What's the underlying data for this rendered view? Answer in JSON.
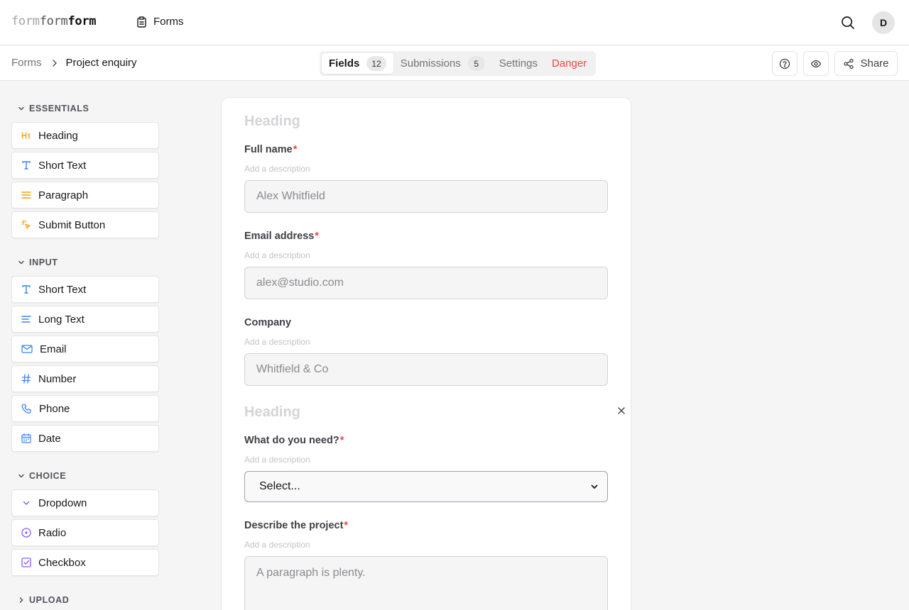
{
  "app": {
    "logo_parts": [
      "form",
      "form",
      "form"
    ],
    "nav_label": "Forms",
    "user_initial": "D"
  },
  "breadcrumb": {
    "parent": "Forms",
    "current": "Project enquiry"
  },
  "tabs": [
    {
      "label": "Fields",
      "count": "12",
      "active": true
    },
    {
      "label": "Submissions",
      "count": "5",
      "active": false
    },
    {
      "label": "Settings",
      "active": false
    },
    {
      "label": "Danger",
      "active": false
    }
  ],
  "actions": {
    "share_label": "Share"
  },
  "sidebar": {
    "sections": [
      {
        "title": "ESSENTIALS",
        "expanded": true,
        "items": [
          {
            "label": "Heading",
            "icon": "heading-icon"
          },
          {
            "label": "Short Text",
            "icon": "text-t-icon"
          },
          {
            "label": "Paragraph",
            "icon": "paragraph-icon"
          },
          {
            "label": "Submit Button",
            "icon": "cursor-click-icon"
          }
        ]
      },
      {
        "title": "INPUT",
        "expanded": true,
        "items": [
          {
            "label": "Short Text",
            "icon": "text-t-icon"
          },
          {
            "label": "Long Text",
            "icon": "long-text-icon"
          },
          {
            "label": "Email",
            "icon": "mail-icon"
          },
          {
            "label": "Number",
            "icon": "hash-icon"
          },
          {
            "label": "Phone",
            "icon": "phone-icon"
          },
          {
            "label": "Date",
            "icon": "calendar-icon"
          }
        ]
      },
      {
        "title": "CHOICE",
        "expanded": true,
        "items": [
          {
            "label": "Dropdown",
            "icon": "chevron-down-icon"
          },
          {
            "label": "Radio",
            "icon": "radio-icon"
          },
          {
            "label": "Checkbox",
            "icon": "checkbox-icon"
          }
        ]
      },
      {
        "title": "UPLOAD",
        "expanded": false,
        "items": []
      }
    ]
  },
  "form": {
    "heading_1": "Heading",
    "heading_2": "Heading",
    "description_placeholder": "Add a description",
    "fields": {
      "full_name": {
        "label": "Full name",
        "required_mark": "*",
        "placeholder": "Alex Whitfield"
      },
      "email": {
        "label": "Email address",
        "required_mark": "*",
        "placeholder": "alex@studio.com"
      },
      "company": {
        "label": "Company",
        "placeholder": "Whitfield & Co"
      },
      "need": {
        "label": "What do you need?",
        "required_mark": "*",
        "selected": "Select..."
      },
      "project": {
        "label": "Describe the project",
        "required_mark": "*",
        "placeholder": "A paragraph is plenty."
      }
    }
  },
  "colors": {
    "danger": "#ef4444",
    "accent_orange": "#f59e0b",
    "accent_blue": "#3b82f6",
    "accent_purple": "#8b5cf6"
  }
}
